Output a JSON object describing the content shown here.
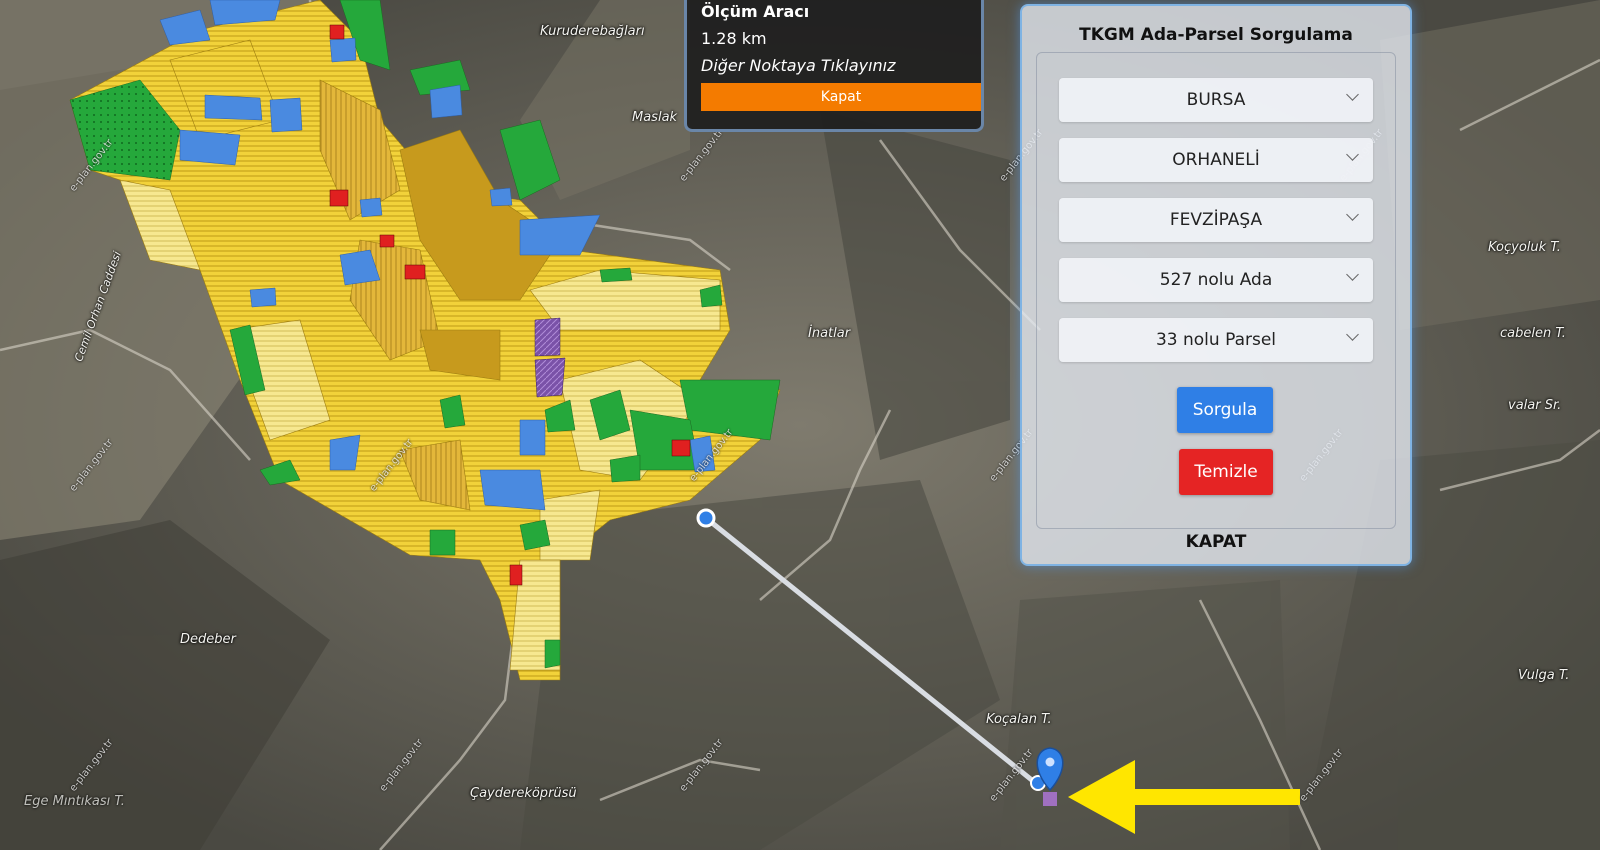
{
  "measure_tool": {
    "title": "Ölçüm Aracı",
    "distance": "1.28 km",
    "hint": "Diğer Noktaya Tıklayınız",
    "close_label": "Kapat",
    "accent": "#f47b00"
  },
  "query_panel": {
    "title": "TKGM Ada-Parsel Sorgulama",
    "province": "BURSA",
    "district": "ORHANELİ",
    "neighborhood": "FEVZİPAŞA",
    "block": "527 nolu Ada",
    "parcel": "33 nolu Parsel",
    "query_label": "Sorgula",
    "clear_label": "Temizle",
    "close_label": "KAPAT"
  },
  "map_labels": {
    "kuruderebogaz": "Kuruderebağları",
    "maslak": "Maslak",
    "inatlar": "İnatlar",
    "kocyoluk": "Koçyoluk T.",
    "cabelen": "cabelen T.",
    "valar": "valar Sr.",
    "vulga": "Vulga T.",
    "dedeber": "Dedeber",
    "kocalan": "Koçalan T.",
    "caydere": "Çaydereköprüsü",
    "ege": "Ege Mıntıkası T.",
    "cemil": "Cemil Orhan Caddesi",
    "watermark": "e-plan.gov.tr"
  },
  "colors": {
    "measure_line": "#d9dde3",
    "pointer_arrow": "#ffe600",
    "marker": "#2f7fe6",
    "query_button": "#2f7fe6",
    "clear_button": "#e52424"
  }
}
